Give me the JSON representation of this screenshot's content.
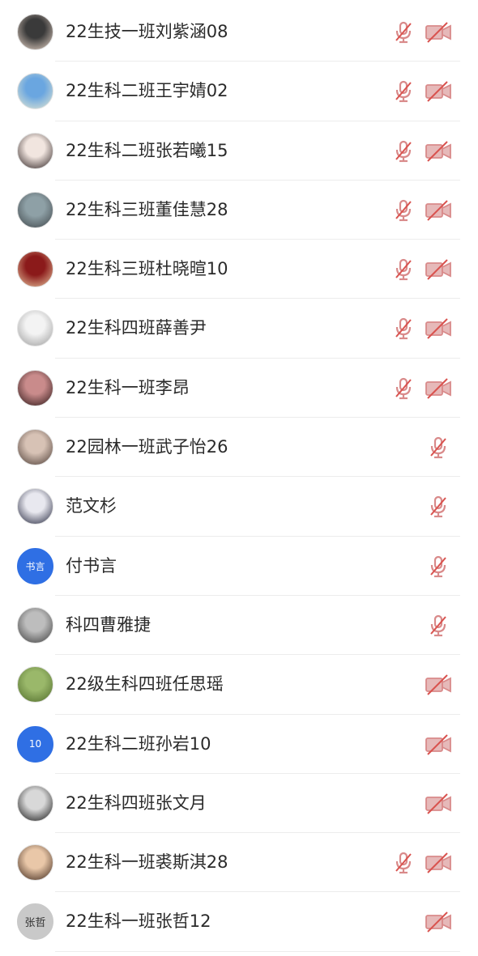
{
  "colors": {
    "muted_icon": "#d98a8a",
    "muted_slash": "#d9534f",
    "divider": "#ececec",
    "name_text": "#2a2a2a",
    "blue_avatar": "#2f6fe4"
  },
  "participants": [
    {
      "name": "22生技一班刘紫涵08",
      "avatar": {
        "type": "photo",
        "colors": [
          "#3a3a3a",
          "#e9d6c8"
        ]
      },
      "mic_muted": true,
      "camera_off": true
    },
    {
      "name": "22生科二班王宇婧02",
      "avatar": {
        "type": "photo",
        "colors": [
          "#6aa6e0",
          "#e5e8d2"
        ]
      },
      "mic_muted": true,
      "camera_off": true
    },
    {
      "name": "22生科二班张若曦15",
      "avatar": {
        "type": "photo",
        "colors": [
          "#f1e5df",
          "#2b2020"
        ]
      },
      "mic_muted": true,
      "camera_off": true
    },
    {
      "name": "22生科三班董佳慧28",
      "avatar": {
        "type": "photo",
        "colors": [
          "#8ea0a6",
          "#3d4448"
        ]
      },
      "mic_muted": true,
      "camera_off": true
    },
    {
      "name": "22生科三班杜晓暄10",
      "avatar": {
        "type": "photo",
        "colors": [
          "#8b1a1a",
          "#e8c7a0"
        ]
      },
      "mic_muted": true,
      "camera_off": true
    },
    {
      "name": "22生科四班薛善尹",
      "avatar": {
        "type": "photo",
        "colors": [
          "#f3f3f3",
          "#9a9a9a"
        ]
      },
      "mic_muted": true,
      "camera_off": true
    },
    {
      "name": "22生科一班李昂",
      "avatar": {
        "type": "photo",
        "colors": [
          "#c98b8b",
          "#2a1414"
        ]
      },
      "mic_muted": true,
      "camera_off": true
    },
    {
      "name": "22园林一班武子怡26",
      "avatar": {
        "type": "photo",
        "colors": [
          "#d7c2b5",
          "#4a3a33"
        ]
      },
      "mic_muted": true,
      "camera_off": false
    },
    {
      "name": "范文杉",
      "avatar": {
        "type": "photo",
        "colors": [
          "#e8e8ef",
          "#20233a"
        ]
      },
      "mic_muted": true,
      "camera_off": false
    },
    {
      "name": "付书言",
      "avatar": {
        "type": "text",
        "text": "书言",
        "bg": "#2f6fe4"
      },
      "mic_muted": true,
      "camera_off": false
    },
    {
      "name": "科四曹雅捷",
      "avatar": {
        "type": "photo",
        "colors": [
          "#bdbdbd",
          "#3b3b3b"
        ]
      },
      "mic_muted": true,
      "camera_off": false
    },
    {
      "name": "22级生科四班任思瑶",
      "avatar": {
        "type": "photo",
        "colors": [
          "#9ab86a",
          "#4f6b2a"
        ]
      },
      "mic_muted": false,
      "camera_off": true
    },
    {
      "name": "22生科二班孙岩10",
      "avatar": {
        "type": "text",
        "text": "10",
        "bg": "#2f6fe4"
      },
      "mic_muted": false,
      "camera_off": true
    },
    {
      "name": "22生科四班张文月",
      "avatar": {
        "type": "photo",
        "colors": [
          "#d8d8d8",
          "#111111"
        ]
      },
      "mic_muted": false,
      "camera_off": true
    },
    {
      "name": "22生科一班裘斯淇28",
      "avatar": {
        "type": "photo",
        "colors": [
          "#e9c7a8",
          "#3a2418"
        ]
      },
      "mic_muted": true,
      "camera_off": true
    },
    {
      "name": "22生科一班张哲12",
      "avatar": {
        "type": "text",
        "text": "张哲",
        "bg": "#c9c9c9",
        "dark": true
      },
      "mic_muted": false,
      "camera_off": true
    }
  ]
}
